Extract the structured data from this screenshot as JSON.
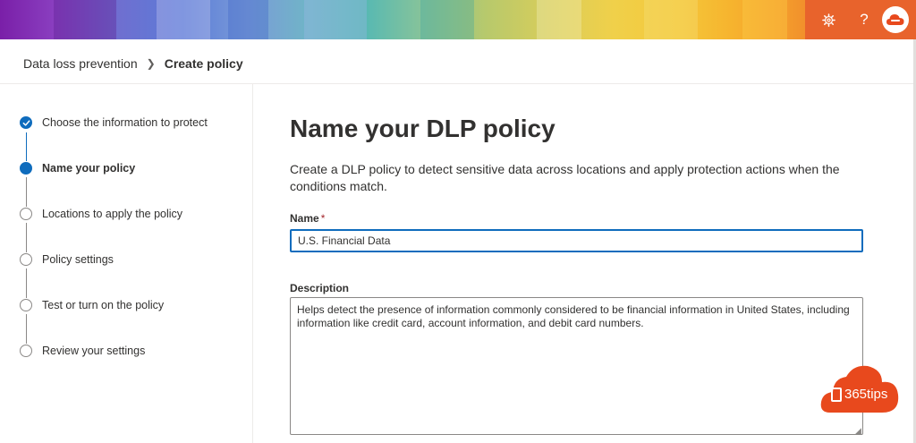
{
  "colors": {
    "accent": "#0f6cbd",
    "banner_actions_bg": "#e8632c",
    "required_asterisk": "#a4262c",
    "watermark": "#e8491d"
  },
  "header": {
    "settings_icon": "gear-icon",
    "help_label": "?",
    "avatar_icon": "cloud-icon"
  },
  "breadcrumb": {
    "root": "Data loss prevention",
    "current": "Create policy"
  },
  "wizard": {
    "steps": [
      {
        "label": "Choose the information to protect",
        "state": "completed"
      },
      {
        "label": "Name your policy",
        "state": "current"
      },
      {
        "label": "Locations to apply the policy",
        "state": "pending"
      },
      {
        "label": "Policy settings",
        "state": "pending"
      },
      {
        "label": "Test or turn on the policy",
        "state": "pending"
      },
      {
        "label": "Review your settings",
        "state": "pending"
      }
    ]
  },
  "main": {
    "title": "Name your DLP policy",
    "description": "Create a DLP policy to detect sensitive data across locations and apply protection actions when the conditions match.",
    "name_field": {
      "label": "Name",
      "required_marker": "*",
      "value": "U.S. Financial Data"
    },
    "description_field": {
      "label": "Description",
      "value": "Helps detect the presence of information commonly considered to be financial information in United States, including information like credit card, account information, and debit card numbers."
    }
  },
  "watermark": {
    "text": "365tips"
  }
}
